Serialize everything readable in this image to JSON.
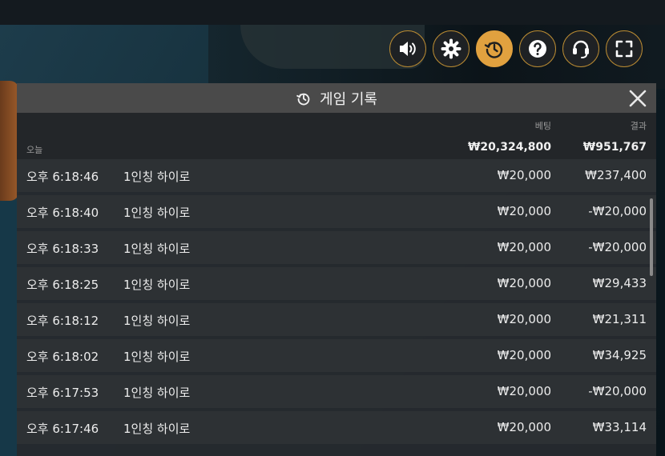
{
  "panel": {
    "title": "게임 기록",
    "columns": {
      "bet": "베팅",
      "result": "결과"
    },
    "summary": {
      "label": "오늘",
      "bet_total": "₩20,324,800",
      "result_total": "₩951,767"
    },
    "rows": [
      {
        "time": "오후 6:18:46",
        "game": "1인칭 하이로",
        "bet": "₩20,000",
        "result": "₩237,400"
      },
      {
        "time": "오후 6:18:40",
        "game": "1인칭 하이로",
        "bet": "₩20,000",
        "result": "-₩20,000"
      },
      {
        "time": "오후 6:18:33",
        "game": "1인칭 하이로",
        "bet": "₩20,000",
        "result": "-₩20,000"
      },
      {
        "time": "오후 6:18:25",
        "game": "1인칭 하이로",
        "bet": "₩20,000",
        "result": "₩29,433"
      },
      {
        "time": "오후 6:18:12",
        "game": "1인칭 하이로",
        "bet": "₩20,000",
        "result": "₩21,311"
      },
      {
        "time": "오후 6:18:02",
        "game": "1인칭 하이로",
        "bet": "₩20,000",
        "result": "₩34,925"
      },
      {
        "time": "오후 6:17:53",
        "game": "1인칭 하이로",
        "bet": "₩20,000",
        "result": "-₩20,000"
      },
      {
        "time": "오후 6:17:46",
        "game": "1인칭 하이로",
        "bet": "₩20,000",
        "result": "₩33,114"
      }
    ]
  },
  "controls": [
    {
      "name": "volume-button",
      "icon": "volume-icon"
    },
    {
      "name": "settings-button",
      "icon": "gear-icon"
    },
    {
      "name": "history-button",
      "icon": "history-icon",
      "active": true
    },
    {
      "name": "help-button",
      "icon": "question-icon"
    },
    {
      "name": "support-button",
      "icon": "headset-icon"
    },
    {
      "name": "fullscreen-button",
      "icon": "fullscreen-icon"
    }
  ],
  "colors": {
    "accent": "#e1a13f",
    "button_border": "#b88a32",
    "panel_bg": "#262a2e",
    "title_bar": "#4a4a4a"
  }
}
